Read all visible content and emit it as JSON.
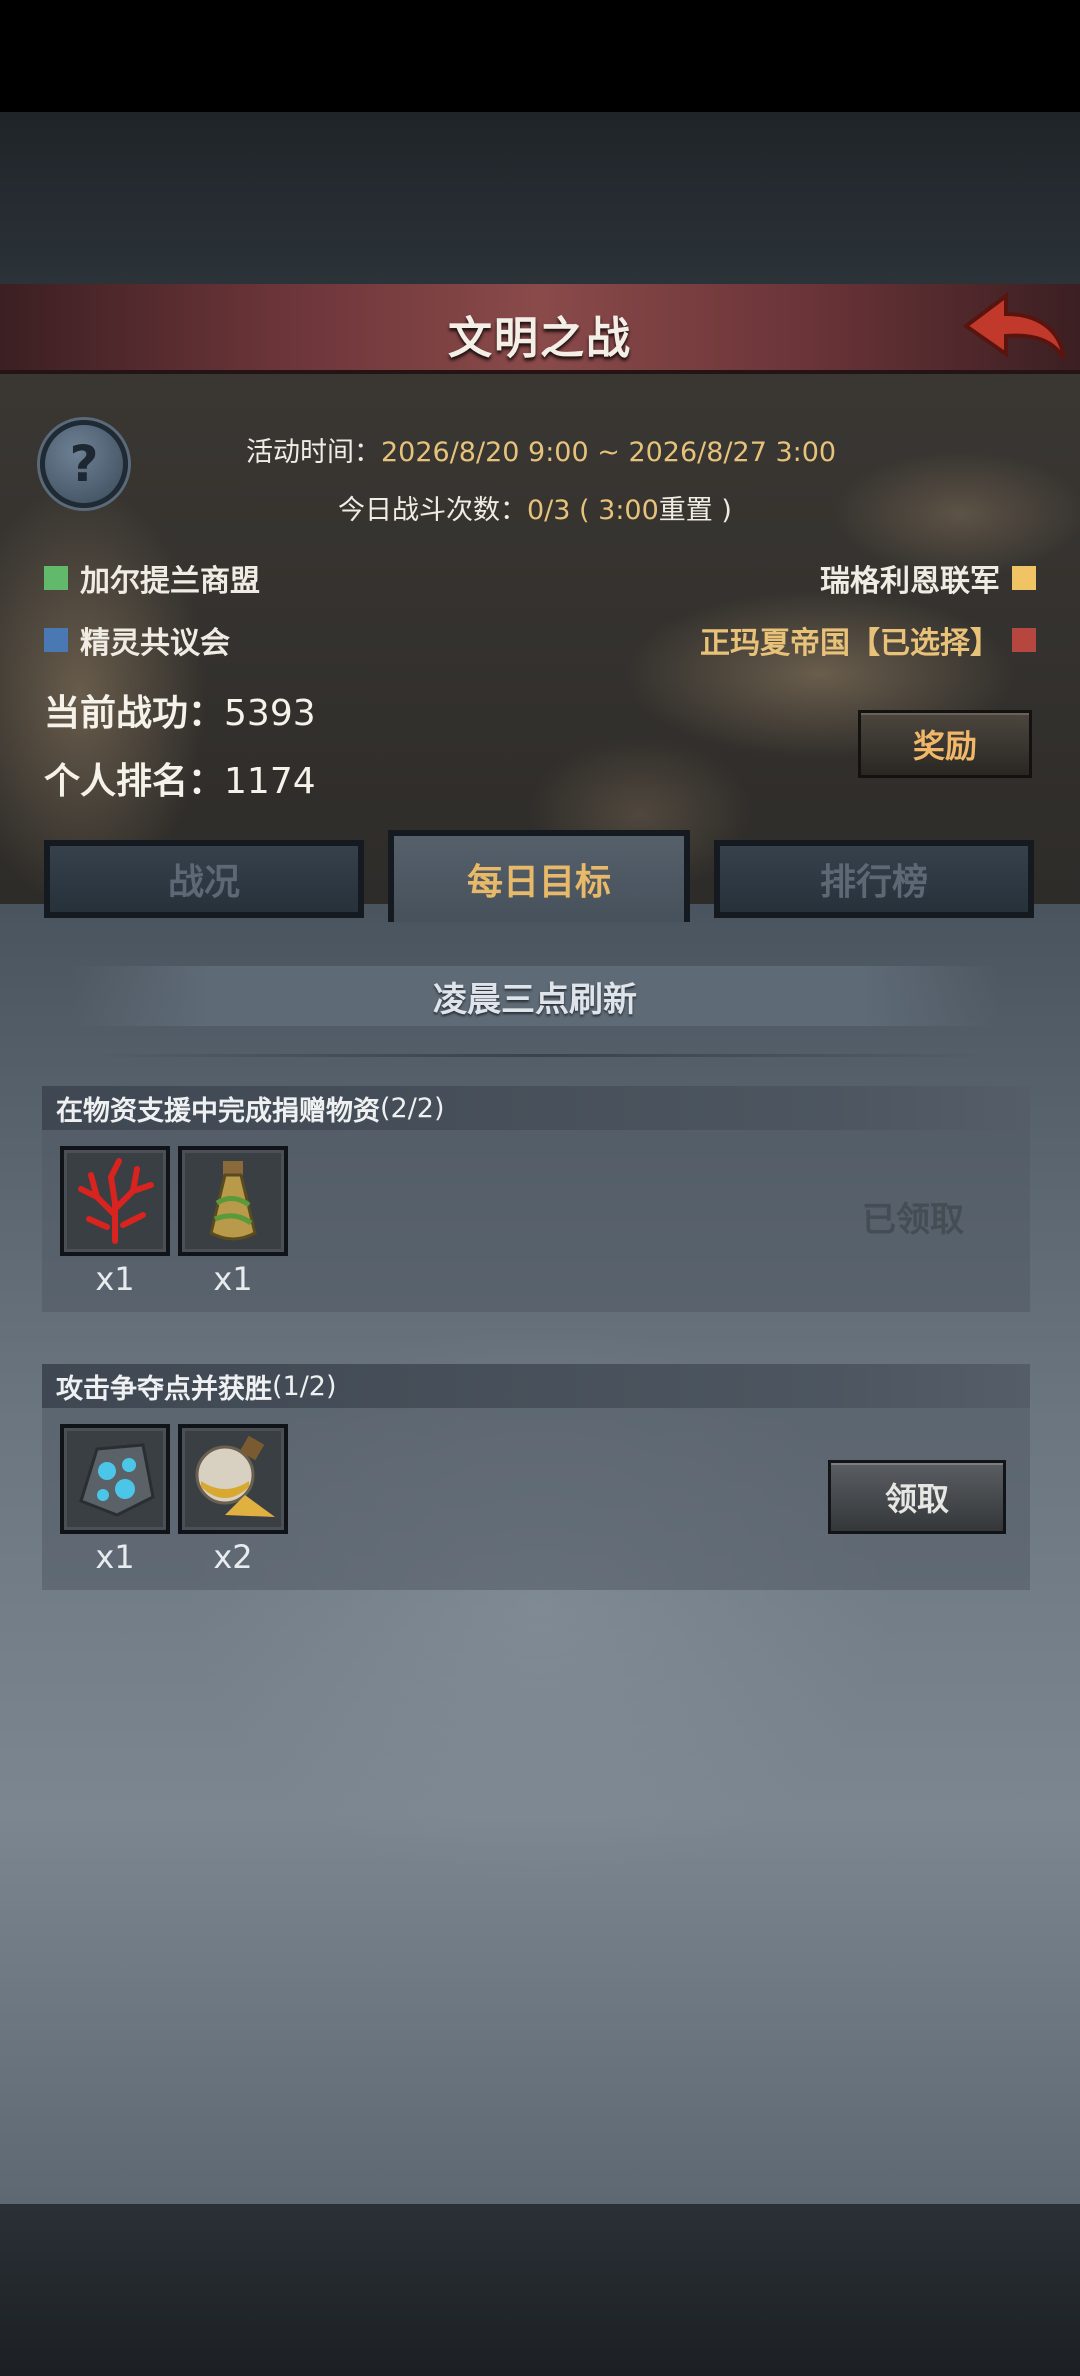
{
  "header": {
    "title": "文明之战"
  },
  "event": {
    "time_label": "活动时间：",
    "time_value": "2026/8/20 9:00 ~ 2026/8/27 3:00",
    "battles_label": "今日战斗次数：",
    "battles_value": "0/3 ( 3:00",
    "battles_reset": "重置 )"
  },
  "factions": [
    {
      "name": "加尔提兰商盟",
      "color": "#62b86b"
    },
    {
      "name": "精灵共议会",
      "color": "#4a78b3"
    },
    {
      "name": "瑞格利恩联军",
      "color": "#f0c364"
    },
    {
      "name": "正玛夏帝国【已选择】",
      "color": "#b5473f"
    }
  ],
  "stats": {
    "merit_label": "当前战功：",
    "merit_value": "5393",
    "rank_label": "个人排名：",
    "rank_value": "1174"
  },
  "reward_button": "奖励",
  "tabs": [
    {
      "label": "战况",
      "active": false
    },
    {
      "label": "每日目标",
      "active": true
    },
    {
      "label": "排行榜",
      "active": false
    }
  ],
  "refresh_banner": "凌晨三点刷新",
  "tasks": [
    {
      "title": "在物资支援中完成捐赠物资",
      "progress": "(2/2)",
      "items": [
        {
          "icon": "red-coral-icon",
          "qty": "x1"
        },
        {
          "icon": "potion-bottle-icon",
          "qty": "x1"
        }
      ],
      "status_text": "已领取"
    },
    {
      "title": "攻击争夺点并获胜",
      "progress": "(1/2)",
      "items": [
        {
          "icon": "blue-crystal-stone-icon",
          "qty": "x1"
        },
        {
          "icon": "gold-dust-flask-icon",
          "qty": "x2"
        }
      ],
      "button_label": "领取"
    }
  ],
  "colors": {
    "accent": "#e6c27a",
    "header_red": "#8a4a4a",
    "back_arrow": "#c0392b"
  }
}
